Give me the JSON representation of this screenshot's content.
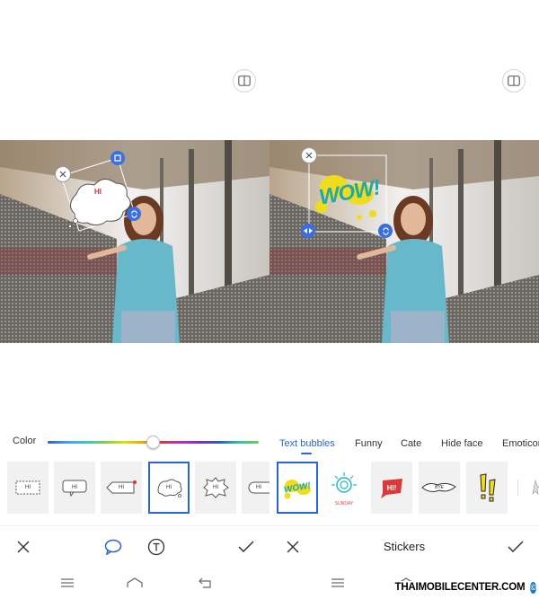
{
  "left_screen": {
    "color_label": "Color",
    "bubble_text": "HI",
    "bubble_thumbs": [
      "HI",
      "HI",
      "HI",
      "HI",
      "HI",
      "HI"
    ],
    "selected_thumb_index": 3,
    "color_slider_fraction": 0.5,
    "bottom_bar": {
      "close_icon": "close-icon",
      "bubble_icon": "speech-bubble-icon",
      "text_icon": "text-circle-icon",
      "confirm_icon": "check-icon"
    }
  },
  "right_screen": {
    "tabs": [
      "Text bubbles",
      "Funny",
      "Cate",
      "Hide face",
      "Emoticon"
    ],
    "active_tab_index": 0,
    "sticker_main_text": "WOW!",
    "sticker_thumbs": [
      "WOW!",
      "SUNDAY",
      "HI!",
      "BYE",
      "!!"
    ],
    "bottom_bar_title": "Stickers"
  },
  "nav_bar": {
    "icons": [
      "menu-icon",
      "home-icon",
      "back-icon"
    ]
  },
  "watermark": {
    "text": "THAIMOBILECENTER.COM",
    "symbol": "©"
  },
  "colors": {
    "accent": "#2a64d8",
    "handle": "#3a6fe0"
  }
}
